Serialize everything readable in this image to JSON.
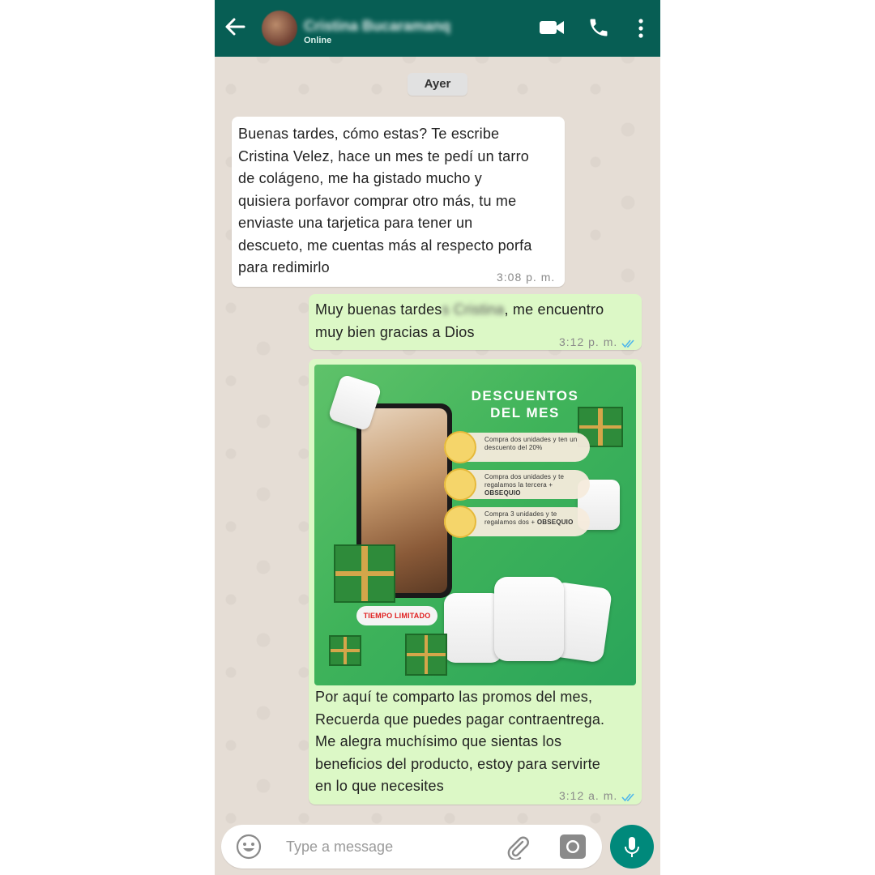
{
  "header": {
    "contact_name": "Cristina Bucaramanq",
    "status": "Online",
    "icons": [
      "back-arrow-icon",
      "video-call-icon",
      "phone-call-icon",
      "more-options-icon"
    ],
    "color": "#075e54"
  },
  "date_separator": "Ayer",
  "messages": [
    {
      "direction": "incoming",
      "lines": [
        "Buenas tardes, cómo estas? Te escribe",
        "Cristina Velez, hace un mes te pedí un tarro",
        "de colágeno, me ha gistado mucho y",
        "quisiera porfavor comprar otro más, tu me",
        "enviaste una tarjetica para tener un",
        "descueto, me cuentas más al respecto porfa",
        "para redimirlo"
      ],
      "time": "3:08 p. m."
    },
    {
      "direction": "outgoing",
      "line1_a": "Muy buenas tardes",
      "line1_blurred": "s Cristina",
      "line1_b": ", me encuentro",
      "line2": "muy bien gracias a Dios",
      "time": "3:12 p. m.",
      "status_icon": "double-check-icon"
    },
    {
      "direction": "outgoing",
      "image": {
        "title_line1": "DESCUENTOS",
        "title_line2": "DEL MES",
        "offers": [
          {
            "text": "Compra dos unidades y ten un descuento del 20%",
            "bold": ""
          },
          {
            "text": "Compra dos unidades y te regalamos la tercera +",
            "bold": "OBSEQUIO"
          },
          {
            "text": "Compra 3 unidades y te regalamos dos +",
            "bold": "OBSEQUIO"
          }
        ],
        "badge": "TIEMPO LIMITADO"
      },
      "lines": [
        "Por aquí te comparto las promos del mes,",
        "Recuerda que puedes pagar contraentrega.",
        "Me alegra muchísimo que sientas los",
        "beneficios del producto, estoy para servirte",
        "en lo que necesites"
      ],
      "time": "3:12 a. m.",
      "status_icon": "double-check-icon"
    }
  ],
  "input": {
    "placeholder": "Type a message",
    "icons": [
      "emoji-icon",
      "attach-icon",
      "camera-icon",
      "mic-icon"
    ]
  },
  "colors": {
    "outgoing_bubble": "#dcf8c6",
    "incoming_bubble": "#ffffff",
    "mic_button": "#00897b",
    "read_ticks": "#4fb6ec"
  }
}
